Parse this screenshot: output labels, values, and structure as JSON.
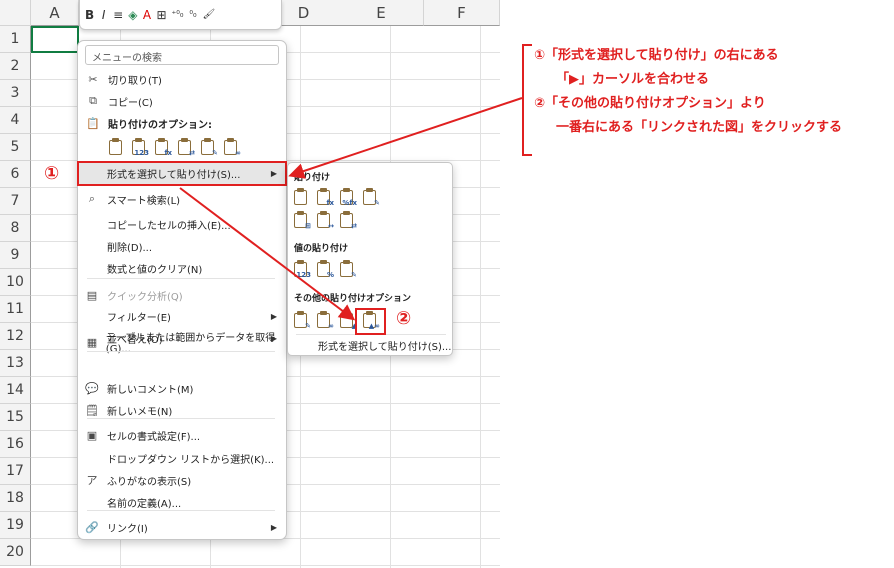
{
  "columns": [
    "A",
    "B",
    "C",
    "D",
    "E",
    "F"
  ],
  "rows": [
    "1",
    "2",
    "3",
    "4",
    "5",
    "6",
    "7",
    "8",
    "9",
    "10",
    "11",
    "12",
    "13",
    "14",
    "15",
    "16",
    "17",
    "18",
    "19",
    "20"
  ],
  "mini_toolbar": {
    "bold": "B",
    "italic": "I",
    "align": "≡",
    "fill": "◈",
    "font_color": "A",
    "border": "⊞",
    "dec_inc": "⁺⁰₀",
    "dec_dec": "⁰₀",
    "format_painter": "🖌"
  },
  "context_menu": {
    "search_placeholder": "メニューの検索",
    "cut": "切り取り(T)",
    "copy": "コピー(C)",
    "paste_options_title": "貼り付けのオプション:",
    "paste_special": "形式を選択して貼り付け(S)...",
    "smart_lookup": "スマート検索(L)",
    "insert_copied": "コピーしたセルの挿入(E)...",
    "delete": "削除(D)...",
    "clear": "数式と値のクリア(N)",
    "quick_analysis": "クイック分析(Q)",
    "filter": "フィルター(E)",
    "sort": "並べ替え(O)",
    "get_data": "テーブルまたは範囲からデータを取得(G)...",
    "new_comment": "新しいコメント(M)",
    "new_note": "新しいメモ(N)",
    "format_cells": "セルの書式設定(F)...",
    "pick_list": "ドロップダウン リストから選択(K)...",
    "furigana": "ふりがなの表示(S)",
    "define_name": "名前の定義(A)...",
    "link": "リンク(I)"
  },
  "submenu": {
    "paste_title": "貼り付け",
    "values_title": "値の貼り付け",
    "other_title": "その他の貼り付けオプション",
    "paste_special": "形式を選択して貼り付け(S)..."
  },
  "markers": {
    "one": "①",
    "two": "②"
  },
  "annotation": {
    "line1": "①「形式を選択して貼り付け」の右にある",
    "line2": "「▶」カーソルを合わせる",
    "line3": "②「その他の貼り付けオプション」より",
    "line4": "一番右にある「リンクされた図」をクリックする"
  },
  "colors": {
    "accent": "#e02020",
    "selection": "#107c41"
  }
}
